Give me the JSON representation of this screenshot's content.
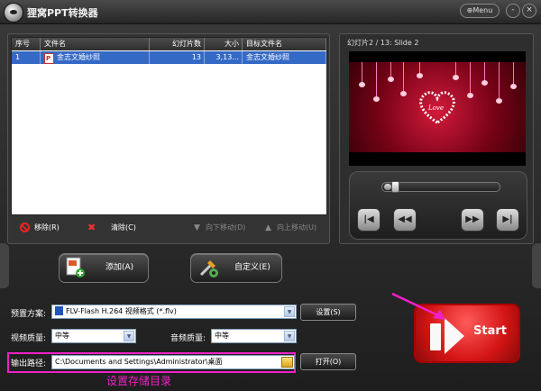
{
  "app": {
    "title": "狸窝PPT转换器",
    "menu_label": "Menu",
    "minimize": "-",
    "close": "×"
  },
  "file_table": {
    "headers": {
      "index": "序号",
      "filename": "文件名",
      "slides": "幻灯片数",
      "size": "大小",
      "target": "目标文件名"
    },
    "rows": [
      {
        "index": "1",
        "filename": "金志文婚纱照",
        "slides": "13",
        "size": "3,13...",
        "target": "金志文婚纱照"
      }
    ]
  },
  "actions": {
    "remove": "移除(R)",
    "clear": "清除(C)",
    "move_down": "向下移动(D)",
    "move_up": "向上移动(U)"
  },
  "preview": {
    "label": "幻灯片2 / 13: Slide 2",
    "slide_text": "Love",
    "progress": 0.08
  },
  "buttons": {
    "add": "添加(A)",
    "customize": "自定义(E)",
    "settings": "设置(S)",
    "open": "打开(O)",
    "start": "Start"
  },
  "settings": {
    "preset_label": "预置方案:",
    "preset_value": "FLV-Flash H.264 视频格式 (*.flv)",
    "video_quality_label": "视频质量:",
    "video_quality": "中等",
    "audio_quality_label": "音频质量:",
    "audio_quality": "中等",
    "output_label": "输出路径:",
    "output_path": "C:\\Documents and Settings\\Administrator\\桌面"
  },
  "annotation": "设置存储目录"
}
